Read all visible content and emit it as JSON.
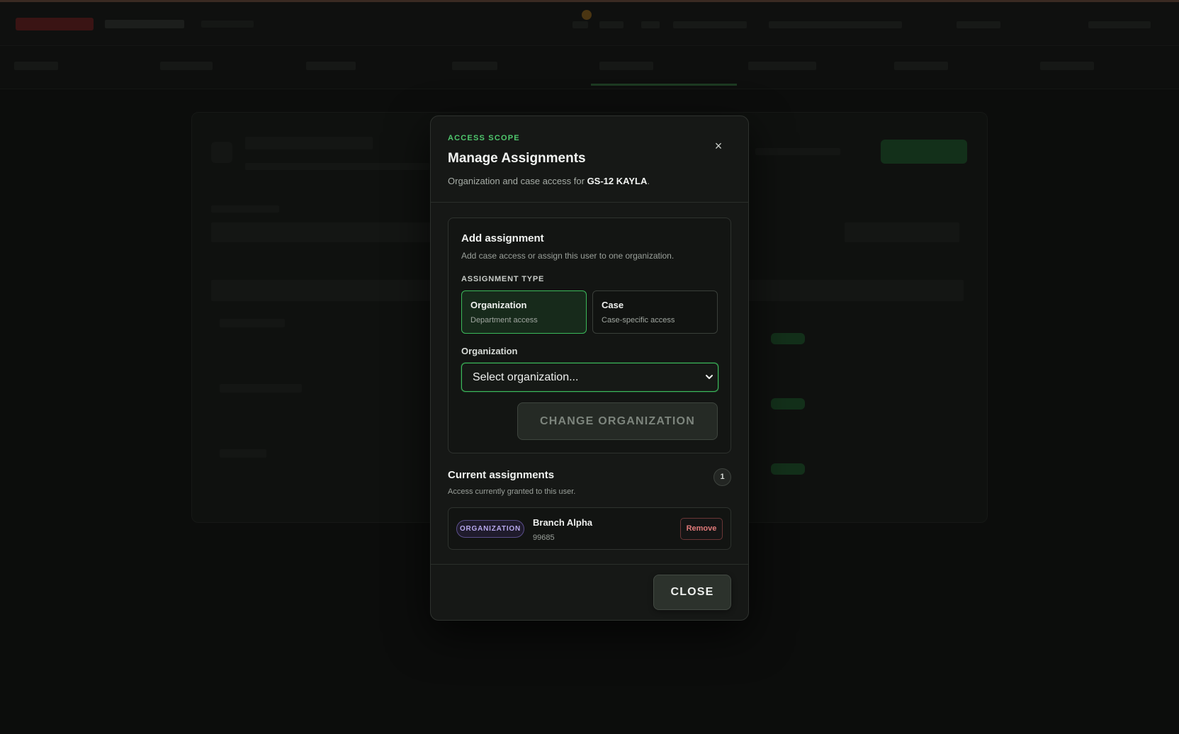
{
  "modal": {
    "eyebrow": "ACCESS SCOPE",
    "title": "Manage Assignments",
    "description_prefix": "Organization and case access for ",
    "user": "GS-12 KAYLA",
    "description_suffix": ".",
    "close_icon": "×"
  },
  "add_assignment": {
    "title": "Add assignment",
    "description": "Add case access or assign this user to one organization.",
    "type_label": "ASSIGNMENT TYPE",
    "types": [
      {
        "name": "Organization",
        "sub": "Department access",
        "selected": true
      },
      {
        "name": "Case",
        "sub": "Case-specific access",
        "selected": false
      }
    ],
    "organization_label": "Organization",
    "organization_select": {
      "value": "Select organization..."
    },
    "change_button": "CHANGE ORGANIZATION"
  },
  "current_assignments": {
    "title": "Current assignments",
    "description": "Access currently granted to this user.",
    "count": "1",
    "items": [
      {
        "badge": "ORGANIZATION",
        "name": "Branch Alpha",
        "id": "99685",
        "remove_label": "Remove"
      }
    ]
  },
  "footer": {
    "close_label": "CLOSE"
  },
  "colors": {
    "accent": "#4fc76d",
    "selected_border": "#3bb85a",
    "badge_purple": "#b7a8ec",
    "remove_red": "#e07a7a"
  },
  "icons": {
    "close": "close-icon",
    "select_arrow": "chevron-down-icon"
  }
}
